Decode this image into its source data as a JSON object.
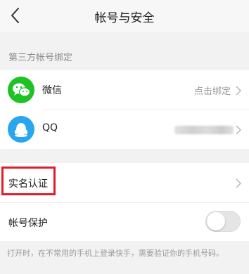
{
  "nav": {
    "title": "帐号与安全"
  },
  "third_party": {
    "header": "第三方帐号绑定",
    "wechat": {
      "label": "微信",
      "status": "点击绑定",
      "icon": "wechat-icon",
      "color": "#1fc125"
    },
    "qq": {
      "label": "QQ",
      "icon": "qq-penguin-icon",
      "color": "#29a6ee"
    }
  },
  "real_name": {
    "label": "实名认证",
    "highlight_color": "#e01e2b"
  },
  "protection": {
    "label": "帐号保护",
    "enabled": false,
    "footnote": "打开时，在不常用的手机上登录快手，需要验证你的手机号码。"
  }
}
